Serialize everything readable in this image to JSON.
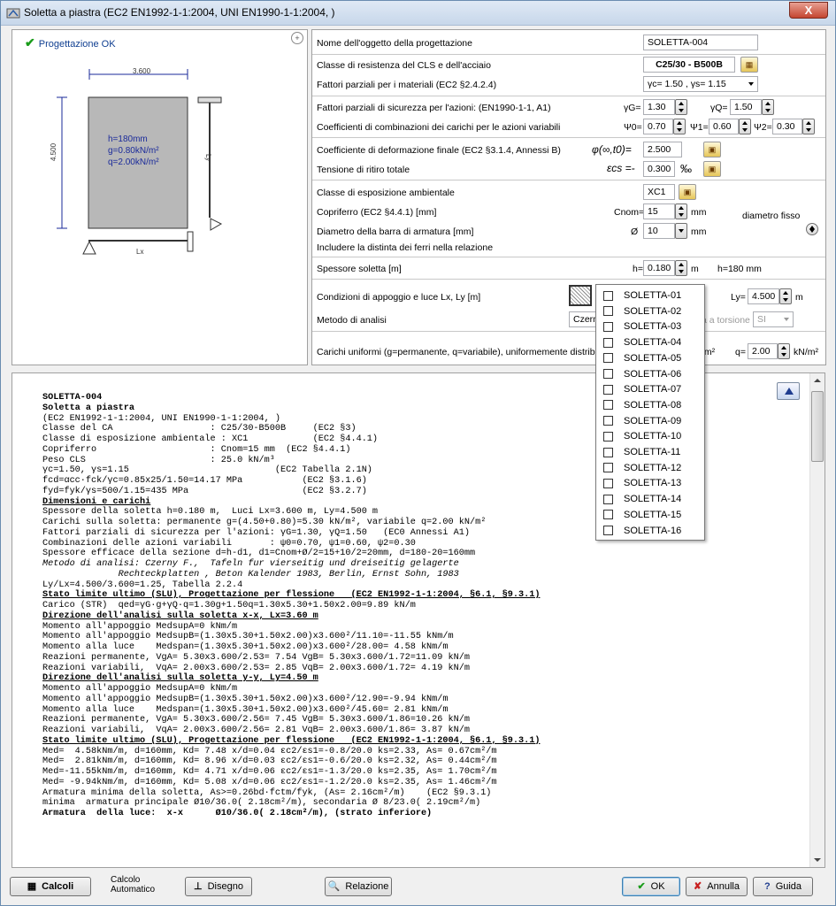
{
  "window": {
    "title": "Soletta a piastra (EC2 EN1992-1-1:2004, UNI EN1990-1-1:2004, )",
    "close_label": "X"
  },
  "status": {
    "label": "Progettazione OK"
  },
  "drawing": {
    "dim_x": "3.600",
    "dim_y": "4.500",
    "loads": [
      "h=180mm",
      "g=0.80kN/m²",
      "q=2.00kN/m²"
    ],
    "lx_label": "Lx",
    "ly_label": "Ly"
  },
  "form": {
    "name_label": "Nome dell'oggetto della progettazione",
    "name_value": "SOLETTA-004",
    "class_label": "Classe di resistenza del CLS e dell'acciaio",
    "class_value": "C25/30 - B500B",
    "partial_mat_label": "Fattori parziali per i materiali (EC2 §2.4.2.4)",
    "partial_mat_value": "γc= 1.50 , γs= 1.15",
    "partial_safety_label": "Fattori parziali di sicurezza per l'azioni: (EN1990-1-1, A1)",
    "gG_label": "γG=",
    "gG_value": "1.30",
    "gQ_label": "γQ=",
    "gQ_value": "1.50",
    "comb_label": "Coefficienti di combinazioni dei carichi per le azioni variabili",
    "psi0_label": "Ψ0=",
    "psi0_value": "0.70",
    "psi1_label": "Ψ1=",
    "psi1_value": "0.60",
    "psi2_label": "Ψ2=",
    "psi2_value": "0.30",
    "creep_label": "Coefficiente di deformazione finale (EC2 §3.1.4, Annessi B)",
    "creep_symbol": "φ(∞,t0)=",
    "creep_value": "2.500",
    "shrink_label": "Tensione di ritiro totale",
    "shrink_symbol": "εcs =-",
    "shrink_value": "0.300",
    "shrink_unit": "‰",
    "exposure_label": "Classe di esposizione ambientale",
    "exposure_value": "XC1",
    "cover_label": "Copriferro (EC2 §4.4.1) [mm]",
    "cover_symbol": "Cnom=",
    "cover_value": "15",
    "cover_unit": "mm",
    "fixed_diam": "diametro fisso",
    "bar_label": "Diametro della barra di armatura [mm]",
    "bar_symbol": "Ø",
    "bar_value": "10",
    "bar_unit": "mm",
    "include_label": "Includere la distinta dei ferri nella relazione",
    "thick_label": "Spessore soletta [m]",
    "thick_symbol": "h=",
    "thick_value": "0.180",
    "thick_unit": "m",
    "thick_mm": "h=180 mm",
    "support_label": "Condizioni di appoggio e luce Lx, Ly [m]",
    "ly_symbol": "Ly=",
    "ly_value": "4.500",
    "ly_unit": "m",
    "method_label": "Metodo di analisi",
    "method_value": "Czerny",
    "torsion_label": "a a torsione",
    "torsion_value": "SI",
    "uniform_label": "Carichi uniformi (g=permanente, q=variabile), uniformemente distribuito [k",
    "g_unit": "/m²",
    "q_symbol": "q=",
    "q_value": "2.00",
    "q_unit": "kN/m²"
  },
  "dropdown_items": [
    "SOLETTA-01",
    "SOLETTA-02",
    "SOLETTA-03",
    "SOLETTA-04",
    "SOLETTA-05",
    "SOLETTA-06",
    "SOLETTA-07",
    "SOLETTA-08",
    "SOLETTA-09",
    "SOLETTA-10",
    "SOLETTA-11",
    "SOLETTA-12",
    "SOLETTA-13",
    "SOLETTA-14",
    "SOLETTA-15",
    "SOLETTA-16"
  ],
  "report": [
    {
      "s": "b",
      "t": "SOLETTA-004"
    },
    {
      "s": "b",
      "t": "Soletta a piastra"
    },
    {
      "s": "",
      "t": "(EC2 EN1992-1-1:2004, UNI EN1990-1-1:2004, )"
    },
    {
      "s": "",
      "t": "Classe del CA                  : C25/30-B500B     (EC2 §3)"
    },
    {
      "s": "",
      "t": "Classe di esposizione ambientale : XC1            (EC2 §4.4.1)"
    },
    {
      "s": "",
      "t": "Copriferro                     : Cnom=15 mm  (EC2 §4.4.1)"
    },
    {
      "s": "",
      "t": "Peso CLS                       : 25.0 kN/m³"
    },
    {
      "s": "",
      "t": "γc=1.50, γs=1.15                           (EC2 Tabella 2.1N)"
    },
    {
      "s": "",
      "t": "fcd=αcc·fck/γc=0.85x25/1.50=14.17 MPa           (EC2 §3.1.6)"
    },
    {
      "s": "",
      "t": "fyd=fyk/γs=500/1.15=435 MPa                     (EC2 §3.2.7)"
    },
    {
      "s": "u",
      "t": "Dimensioni e carichi"
    },
    {
      "s": "",
      "t": "Spessore della soletta h=0.180 m,  Luci Lx=3.600 m, Ly=4.500 m"
    },
    {
      "s": "",
      "t": "Carichi sulla soletta: permanente g=(4.50+0.80)=5.30 kN/m², variabile q=2.00 kN/m²"
    },
    {
      "s": "",
      "t": "Fattori parziali di sicurezza per l'azioni: γG=1.30, γQ=1.50   (EC0 Annessi A1)"
    },
    {
      "s": "",
      "t": "Combinazioni delle azioni variabili       : ψ0=0.70, ψ1=0.60, ψ2=0.30"
    },
    {
      "s": "",
      "t": "Spessore efficace della sezione d=h-d1, d1=Cnom+Ø/2=15+10/2=20mm, d=180-20=160mm"
    },
    {
      "s": "i",
      "t": "Metodo di analisi: Czerny F.,  Tafeln fur vierseitig und dreiseitig gelagerte"
    },
    {
      "s": "i",
      "t": "              Rechteckplatten , Beton Kalender 1983, Berlin, Ernst Sohn, 1983"
    },
    {
      "s": "",
      "t": "Ly/Lx=4.500/3.600=1.25, Tabella 2.2.4"
    },
    {
      "s": "u",
      "t": "Stato limite ultimo (SLU), Progettazione per flessione   (EC2 EN1992-1-1:2004, §6.1, §9.3.1)"
    },
    {
      "s": "",
      "t": "Carico (STR)  qed=γG·g+γQ·q=1.30g+1.50q=1.30x5.30+1.50x2.00=9.89 kN/m"
    },
    {
      "s": "u",
      "t": "Direzione dell'analisi sulla soletta x-x, Lx=3.60 m"
    },
    {
      "s": "",
      "t": "Momento all'appoggio MedsupA=0 kNm/m"
    },
    {
      "s": "",
      "t": "Momento all'appoggio MedsupB=(1.30x5.30+1.50x2.00)x3.600²/11.10=-11.55 kNm/m"
    },
    {
      "s": "",
      "t": "Momento alla luce    Medspan=(1.30x5.30+1.50x2.00)x3.600²/28.00= 4.58 kNm/m"
    },
    {
      "s": "",
      "t": "Reazioni permanente, VgA= 5.30x3.600/2.53= 7.54 VgB= 5.30x3.600/1.72=11.09 kN/m"
    },
    {
      "s": "",
      "t": "Reazioni variabili,  VqA= 2.00x3.600/2.53= 2.85 VqB= 2.00x3.600/1.72= 4.19 kN/m"
    },
    {
      "s": "u",
      "t": "Direzione dell'analisi sulla soletta y-y, Ly=4.50 m"
    },
    {
      "s": "",
      "t": "Momento all'appoggio MedsupA=0 kNm/m"
    },
    {
      "s": "",
      "t": "Momento all'appoggio MedsupB=(1.30x5.30+1.50x2.00)x3.600²/12.90=-9.94 kNm/m"
    },
    {
      "s": "",
      "t": "Momento alla luce    Medspan=(1.30x5.30+1.50x2.00)x3.600²/45.60= 2.81 kNm/m"
    },
    {
      "s": "",
      "t": "Reazioni permanente, VgA= 5.30x3.600/2.56= 7.45 VgB= 5.30x3.600/1.86=10.26 kN/m"
    },
    {
      "s": "",
      "t": "Reazioni variabili,  VqA= 2.00x3.600/2.56= 2.81 VqB= 2.00x3.600/1.86= 3.87 kN/m"
    },
    {
      "s": "u",
      "t": "Stato limite ultimo (SLU), Progettazione per flessione   (EC2 EN1992-1-1:2004, §6.1, §9.3.1)"
    },
    {
      "s": "",
      "t": "Med=  4.58kNm/m, d=160mm, Kd= 7.48 x/d=0.04 εc2/εs1=-0.8/20.0 ks=2.33, As= 0.67cm²/m"
    },
    {
      "s": "",
      "t": "Med=  2.81kNm/m, d=160mm, Kd= 8.96 x/d=0.03 εc2/εs1=-0.6/20.0 ks=2.32, As= 0.44cm²/m"
    },
    {
      "s": "",
      "t": "Med=-11.55kNm/m, d=160mm, Kd= 4.71 x/d=0.06 εc2/εs1=-1.3/20.0 ks=2.35, As= 1.70cm²/m"
    },
    {
      "s": "",
      "t": "Med= -9.94kNm/m, d=160mm, Kd= 5.08 x/d=0.06 εc2/εs1=-1.2/20.0 ks=2.35, As= 1.46cm²/m"
    },
    {
      "s": "",
      "t": "Armatura minima della soletta, As>=0.26bd·fctm/fyk, (As= 2.16cm²/m)    (EC2 §9.3.1)"
    },
    {
      "s": "",
      "t": "minima  armatura principale Ø10/36.0( 2.18cm²/m), secondaria Ø 8/23.0( 2.19cm²/m)"
    },
    {
      "s": "b",
      "t": "Armatura  della luce:  x-x      Ø10/36.0( 2.18cm²/m), (strato inferiore)"
    }
  ],
  "buttons": {
    "calc": "Calcoli",
    "auto_calc": "Calcolo\nAutomatico",
    "drawing": "Disegno",
    "report": "Relazione",
    "ok": "OK",
    "cancel": "Annulla",
    "help": "Guida"
  }
}
